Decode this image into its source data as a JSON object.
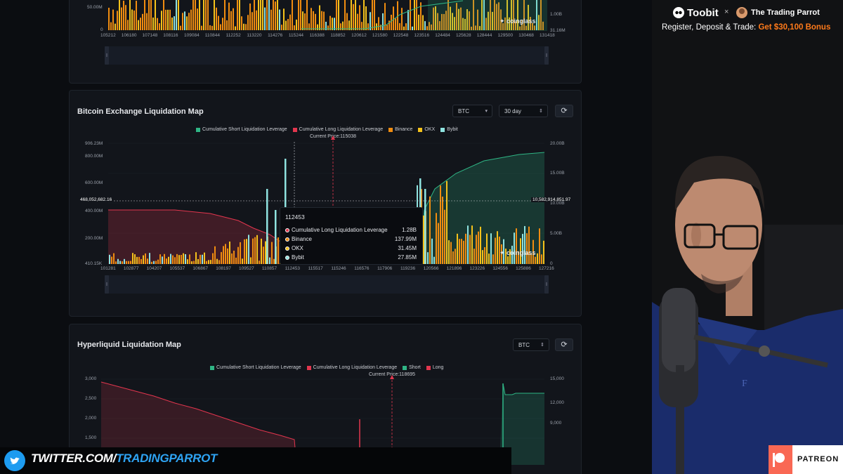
{
  "top_panel": {
    "y_left_labels": [
      "50.00M",
      "0"
    ],
    "y_right_labels": [
      "1.00B",
      "31.16M"
    ],
    "x_labels": [
      "105212",
      "106180",
      "107148",
      "108116",
      "109084",
      "110844",
      "112252",
      "113220",
      "114276",
      "115244",
      "116388",
      "118852",
      "120612",
      "121580",
      "122548",
      "123516",
      "124484",
      "125628",
      "128444",
      "129500",
      "130468",
      "131418"
    ],
    "watermark": "coinglass"
  },
  "exchange_map": {
    "title": "Bitcoin Exchange Liquidation Map",
    "asset_select": "BTC",
    "range_select": "30 day",
    "legend": [
      {
        "label": "Cumulative Short Liquidation Leverage",
        "color": "#2fb585"
      },
      {
        "label": "Cumulative Long Liquidation Leverage",
        "color": "#e2364e"
      },
      {
        "label": "Binance",
        "color": "#f08c10"
      },
      {
        "label": "OKX",
        "color": "#f5c21b"
      },
      {
        "label": "Bybit",
        "color": "#8fe3e0"
      }
    ],
    "current_price": "Current Price:115038",
    "y_left_labels": [
      "906.23M",
      "800.00M",
      "600.00M",
      "400.00M",
      "200.00M",
      "410.15K"
    ],
    "y_right_labels": [
      "20.00B",
      "15.00B",
      "10.00B",
      "5.00B",
      "0"
    ],
    "x_labels": [
      "101281",
      "102877",
      "104207",
      "105537",
      "106867",
      "108197",
      "109527",
      "110857",
      "112453",
      "115517",
      "115246",
      "116576",
      "117906",
      "119236",
      "120566",
      "121896",
      "123226",
      "124556",
      "125886",
      "127216"
    ],
    "crosshair_left": "468,052,682.16",
    "crosshair_right": "10,582,914,851.97",
    "tooltip": {
      "price": "112453",
      "rows": [
        {
          "label": "Cumulative Long Liquidation Leverage",
          "value": "1.28B",
          "color": "#e2364e"
        },
        {
          "label": "Binance",
          "value": "137.99M",
          "color": "#f08c10"
        },
        {
          "label": "OKX",
          "value": "31.45M",
          "color": "#f5c21b"
        },
        {
          "label": "Bybit",
          "value": "27.85M",
          "color": "#8fe3e0"
        }
      ]
    },
    "watermark": "coinglass"
  },
  "hyperliquid_map": {
    "title": "Hyperliquid Liquidation Map",
    "asset_select": "BTC",
    "legend": [
      {
        "label": "Cumulative Short Liquidation Leverage",
        "color": "#2fb585"
      },
      {
        "label": "Cumulative Long Liquidation Leverage",
        "color": "#e2364e"
      },
      {
        "label": "Short",
        "color": "#2fb585"
      },
      {
        "label": "Long",
        "color": "#e2364e"
      }
    ],
    "current_price": "Current Price:118695",
    "y_left_labels": [
      "3,000",
      "2,500",
      "2,000",
      "1,500"
    ],
    "y_right_labels": [
      "15,000",
      "12,000",
      "9,000"
    ]
  },
  "sponsor": {
    "brand_a": "Toobit",
    "brand_b": "The Trading Parrot",
    "cta_prefix": "Register, Deposit & Trade:",
    "cta_bonus": "Get $30,100 Bonus"
  },
  "twitter_banner": {
    "prefix": "TWITTER.COM/",
    "handle": "TRADINGPARROT"
  },
  "patreon": {
    "label": "PATREON"
  }
}
